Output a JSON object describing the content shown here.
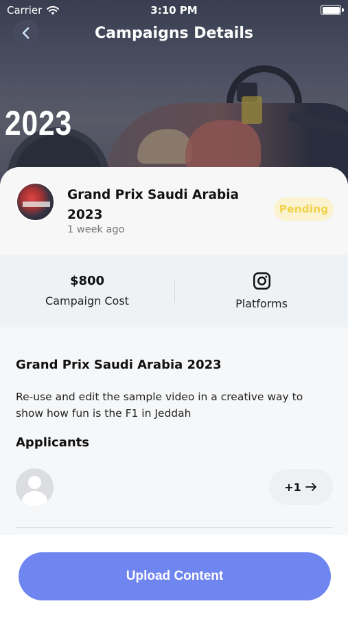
{
  "status_bar": {
    "carrier": "Carrier",
    "time": "3:10 PM"
  },
  "header": {
    "title": "Campaigns Details",
    "back_icon": "chevron-left-icon"
  },
  "hero": {
    "year_text": "2023"
  },
  "campaign": {
    "title": "Grand Prix Saudi Arabia 2023",
    "posted": "1 week ago",
    "status": "Pending"
  },
  "stats": {
    "cost_value": "$800",
    "cost_label": "Campaign Cost",
    "platforms_label": "Platforms",
    "platform_icon": "instagram-icon"
  },
  "description": {
    "title": "Grand Prix Saudi Arabia 2023",
    "text": "Re-use and edit the sample video in a creative way to show how fun is the F1 in Jeddah"
  },
  "applicants": {
    "title": "Applicants",
    "more_count": "+1"
  },
  "actions": {
    "upload_label": "Upload Content"
  },
  "colors": {
    "accent": "#6f85f0",
    "pending_bg": "#fbf3cf",
    "pending_text": "#f1d24e",
    "stats_bg": "#eef2f5"
  }
}
